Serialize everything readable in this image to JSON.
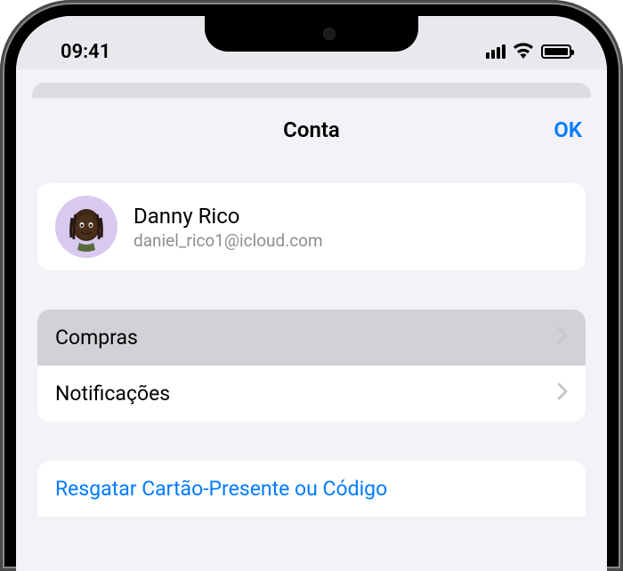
{
  "statusBar": {
    "time": "09:41"
  },
  "modal": {
    "title": "Conta",
    "doneButton": "OK"
  },
  "profile": {
    "name": "Danny Rico",
    "email": "daniel_rico1@icloud.com"
  },
  "menuItems": {
    "purchases": "Compras",
    "notifications": "Notificações"
  },
  "actions": {
    "redeemGiftCard": "Resgatar Cartão-Presente ou Código"
  }
}
